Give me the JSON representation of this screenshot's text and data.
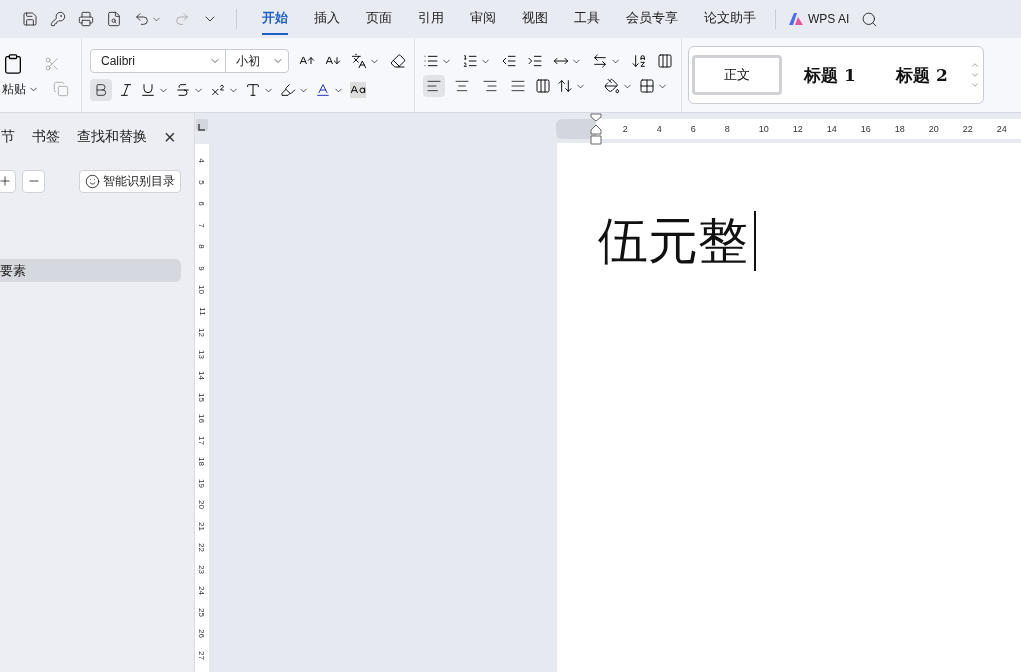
{
  "menu_tabs": [
    {
      "label": "开始",
      "selected": true
    },
    {
      "label": "插入",
      "selected": false
    },
    {
      "label": "页面",
      "selected": false
    },
    {
      "label": "引用",
      "selected": false
    },
    {
      "label": "审阅",
      "selected": false
    },
    {
      "label": "视图",
      "selected": false
    },
    {
      "label": "工具",
      "selected": false
    },
    {
      "label": "会员专享",
      "selected": false
    },
    {
      "label": "论文助手",
      "selected": false
    }
  ],
  "ai_button": {
    "label": "WPS AI"
  },
  "ribbon": {
    "paste_label": "粘贴",
    "font_name": "Calibri",
    "font_size": "小初",
    "bold": true,
    "align_buttons": [
      {
        "kind": "left",
        "selected": true
      },
      {
        "kind": "center",
        "selected": false
      },
      {
        "kind": "right",
        "selected": false
      },
      {
        "kind": "justify",
        "selected": false
      }
    ],
    "styles": [
      {
        "label": "正文",
        "selected": true,
        "kind": "body"
      },
      {
        "label": "标题 1",
        "selected": false,
        "kind": "heading"
      },
      {
        "label": "标题 2",
        "selected": false,
        "kind": "heading"
      }
    ]
  },
  "nav_panel": {
    "tabs": [
      {
        "label": "节"
      },
      {
        "label": "书签"
      },
      {
        "label": "查找和替换"
      }
    ],
    "close": "×",
    "recognize_button": "智能识别目录",
    "items": [
      {
        "label": "要素",
        "selected": true
      }
    ]
  },
  "horizontal_ruler": [
    "2",
    "4",
    "6",
    "8",
    "10",
    "12",
    "14",
    "16",
    "18",
    "20",
    "22",
    "24"
  ],
  "vertical_ruler": [
    "4",
    "5",
    "6",
    "7",
    "8",
    "9",
    "10",
    "11",
    "12",
    "13",
    "14",
    "15",
    "16",
    "17",
    "18",
    "19",
    "20",
    "21",
    "22",
    "23",
    "24",
    "25",
    "26",
    "27"
  ],
  "document": {
    "text": "伍元整"
  }
}
